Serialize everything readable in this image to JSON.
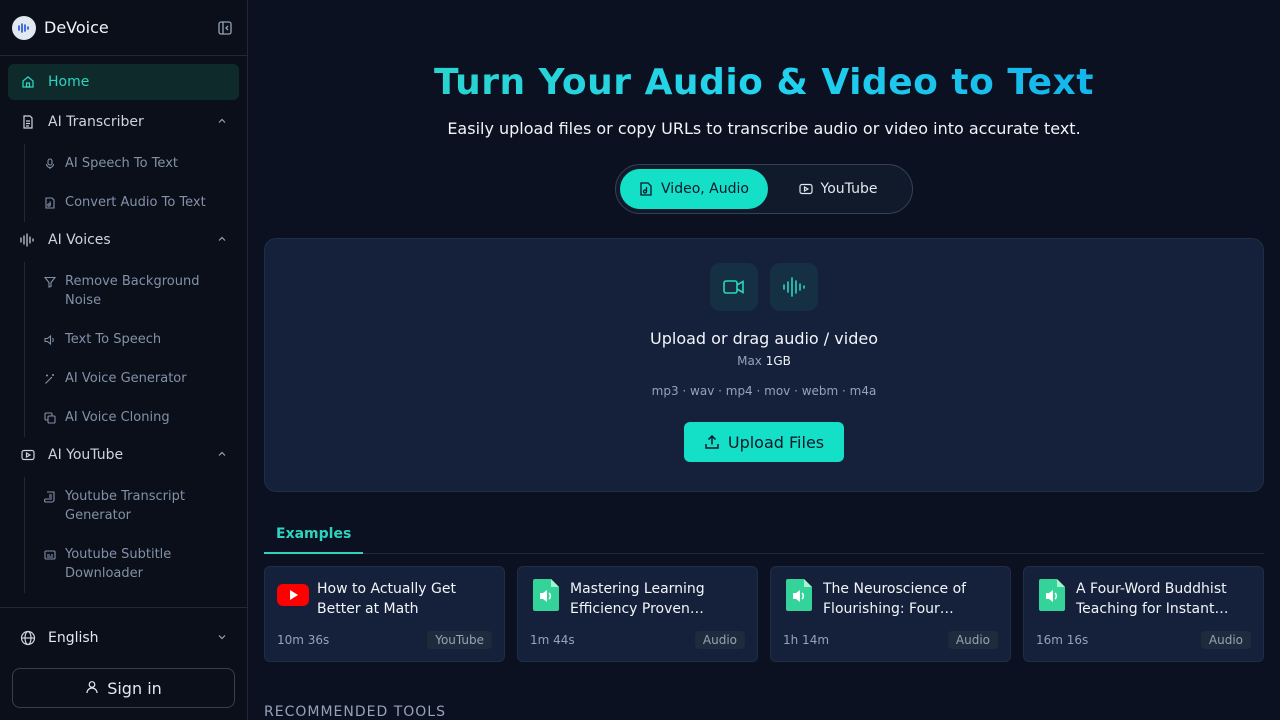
{
  "app": {
    "name": "DeVoice"
  },
  "sidebar": {
    "home": "Home",
    "groups": [
      {
        "label": "AI Transcriber",
        "items": [
          "AI Speech To Text",
          "Convert Audio To Text"
        ]
      },
      {
        "label": "AI Voices",
        "items": [
          "Remove Background Noise",
          "Text To Speech",
          "AI Voice Generator",
          "AI Voice Cloning"
        ]
      },
      {
        "label": "AI YouTube",
        "items": [
          "Youtube Transcript Generator",
          "Youtube Subtitle Downloader"
        ]
      }
    ],
    "language": "English",
    "sign_in": "Sign in"
  },
  "hero": {
    "title": "Turn Your Audio & Video to Text",
    "subtitle": "Easily upload files or copy URLs to transcribe audio or video into accurate text."
  },
  "mode": {
    "active": "Video, Audio",
    "other": "YouTube"
  },
  "upload": {
    "title": "Upload or drag audio / video",
    "max_label": "Max",
    "max_value": "1GB",
    "formats": "mp3 · wav · mp4 · mov · webm · m4a",
    "button": "Upload Files"
  },
  "tabs": {
    "examples": "Examples"
  },
  "examples": [
    {
      "title": "How to Actually Get Better at Math",
      "duration": "10m 36s",
      "badge": "YouTube",
      "icon": "youtube-icon"
    },
    {
      "title": "Mastering Learning Efficiency Proven…",
      "duration": "1m 44s",
      "badge": "Audio",
      "icon": "audio-file-icon"
    },
    {
      "title": "The Neuroscience of Flourishing: Four…",
      "duration": "1h 14m",
      "badge": "Audio",
      "icon": "audio-file-icon"
    },
    {
      "title": "A Four-Word Buddhist Teaching for Instant…",
      "duration": "16m 16s",
      "badge": "Audio",
      "icon": "audio-file-icon"
    }
  ],
  "recommended": "RECOMMENDED TOOLS",
  "colors": {
    "accent": "#14e0c8",
    "background": "#0b1120",
    "panel": "#15213a"
  }
}
